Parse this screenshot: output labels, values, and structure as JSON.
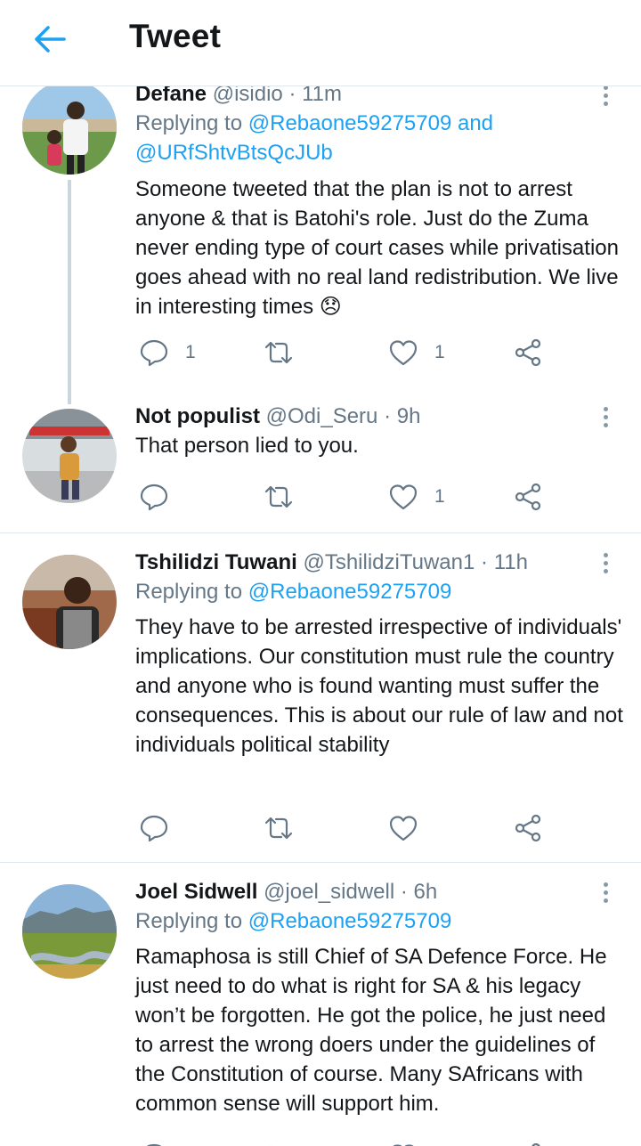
{
  "header": {
    "title": "Tweet"
  },
  "tweets": [
    {
      "name": "Defane",
      "handle": "@isidio",
      "time": "11m",
      "reply_prefix": "Replying to",
      "reply_user1": "@Rebaone59275709",
      "reply_and": "and",
      "reply_user2": "@URfShtvBtsQcJUb",
      "text": "Someone tweeted that the plan is not to arrest anyone & that is Batohi's role. Just do the Zuma never ending type of court cases while privatisation goes ahead with no real land redistribution. We live in interesting times",
      "emoji": "😞",
      "reply_count": "1",
      "like_count": "1"
    },
    {
      "name": "Not populist",
      "handle": "@Odi_Seru",
      "time": "9h",
      "text": "That person lied to you.",
      "like_count": "1"
    },
    {
      "name": "Tshilidzi Tuwani",
      "handle": "@TshilidziTuwan1",
      "time": "11h",
      "reply_prefix": "Replying to",
      "reply_user1": "@Rebaone59275709",
      "text": "They have to be arrested irrespective of individuals' implications. Our constitution must rule the country and anyone who is found wanting must suffer the consequences. This is about our rule of law and not individuals political stability"
    },
    {
      "name": "Joel Sidwell",
      "handle": "@joel_sidwell",
      "time": "6h",
      "reply_prefix": "Replying to",
      "reply_user1": "@Rebaone59275709",
      "text": "Ramaphosa is still Chief of SA Defence Force. He just need to do what is right for SA & his legacy won’t be forgotten. He got the police, he just need to arrest the wrong doers under the guidelines of the Constitution of course. Many SAfricans with common sense will support him."
    }
  ],
  "separator_dot": "·",
  "colors": {
    "accent": "#1da1f2",
    "secondary": "#657786",
    "divider": "#e1e8ed"
  },
  "icons": [
    "back-arrow-icon",
    "more-vertical-icon",
    "reply-icon",
    "retweet-icon",
    "like-icon",
    "share-icon"
  ]
}
